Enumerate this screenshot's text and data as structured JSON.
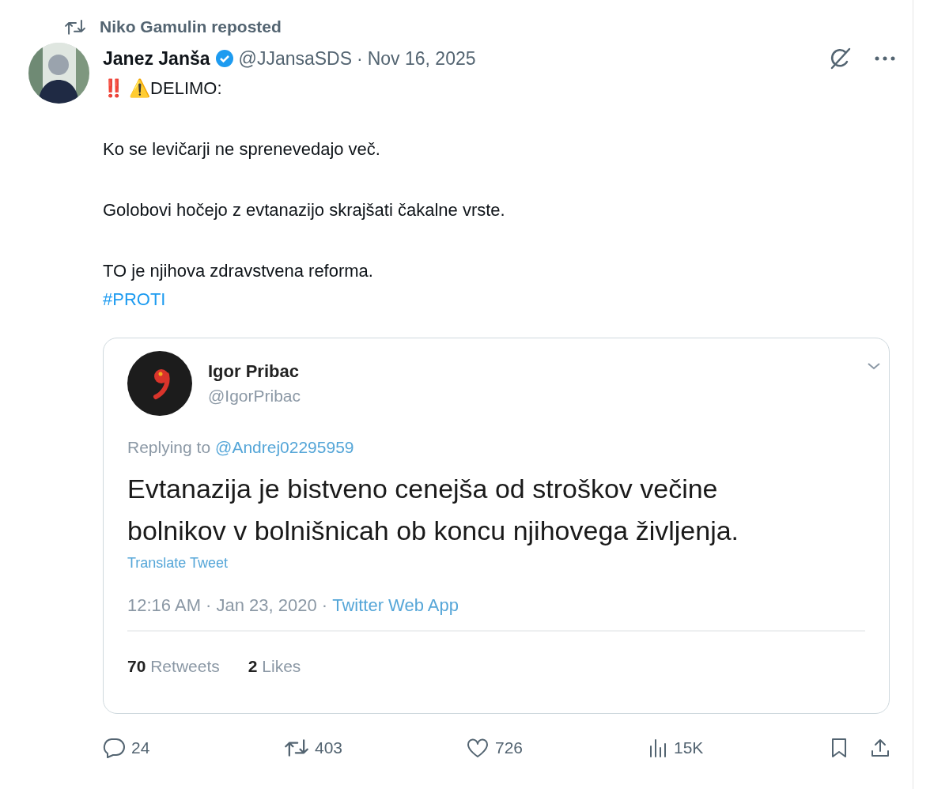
{
  "repost_line": {
    "text": "Niko Gamulin reposted"
  },
  "author": {
    "name": "Janez Janša",
    "verified": true,
    "handle": "@JJansaSDS",
    "separator": "·",
    "date": "Nov 16, 2025"
  },
  "body": [
    {
      "kind": "text",
      "text": "‼️ ⚠️DELIMO:"
    },
    {
      "kind": "text",
      "text": "Ko se levičarji ne sprenevedajo več."
    },
    {
      "kind": "text",
      "text": "Golobovi hočejo z evtanazijo skrajšati čakalne vrste."
    },
    {
      "kind": "text",
      "text": "TO je njihova zdravstvena reforma."
    },
    {
      "kind": "hashtag",
      "text": "#PROTI"
    }
  ],
  "quoted_image": {
    "name": "Igor Pribac",
    "handle": "@IgorPribac",
    "replying_prefix": "Replying to",
    "replying_handle": "@Andrej02295959",
    "text": "Evtanazija je bistveno cenejša od stroškov večine bolnikov v bolnišnicah ob koncu njihovega življenja.",
    "translate": "Translate Tweet",
    "timestamp": "12:16 AM · Jan 23, 2020 ·",
    "source": "Twitter Web App",
    "stats": [
      {
        "count": "70",
        "label": "Retweets"
      },
      {
        "count": "2",
        "label": "Likes"
      }
    ]
  },
  "actions": [
    {
      "kind": "reply",
      "count": "24"
    },
    {
      "kind": "repost",
      "count": "403"
    },
    {
      "kind": "like",
      "count": "726"
    },
    {
      "kind": "views",
      "count": "15K"
    }
  ]
}
